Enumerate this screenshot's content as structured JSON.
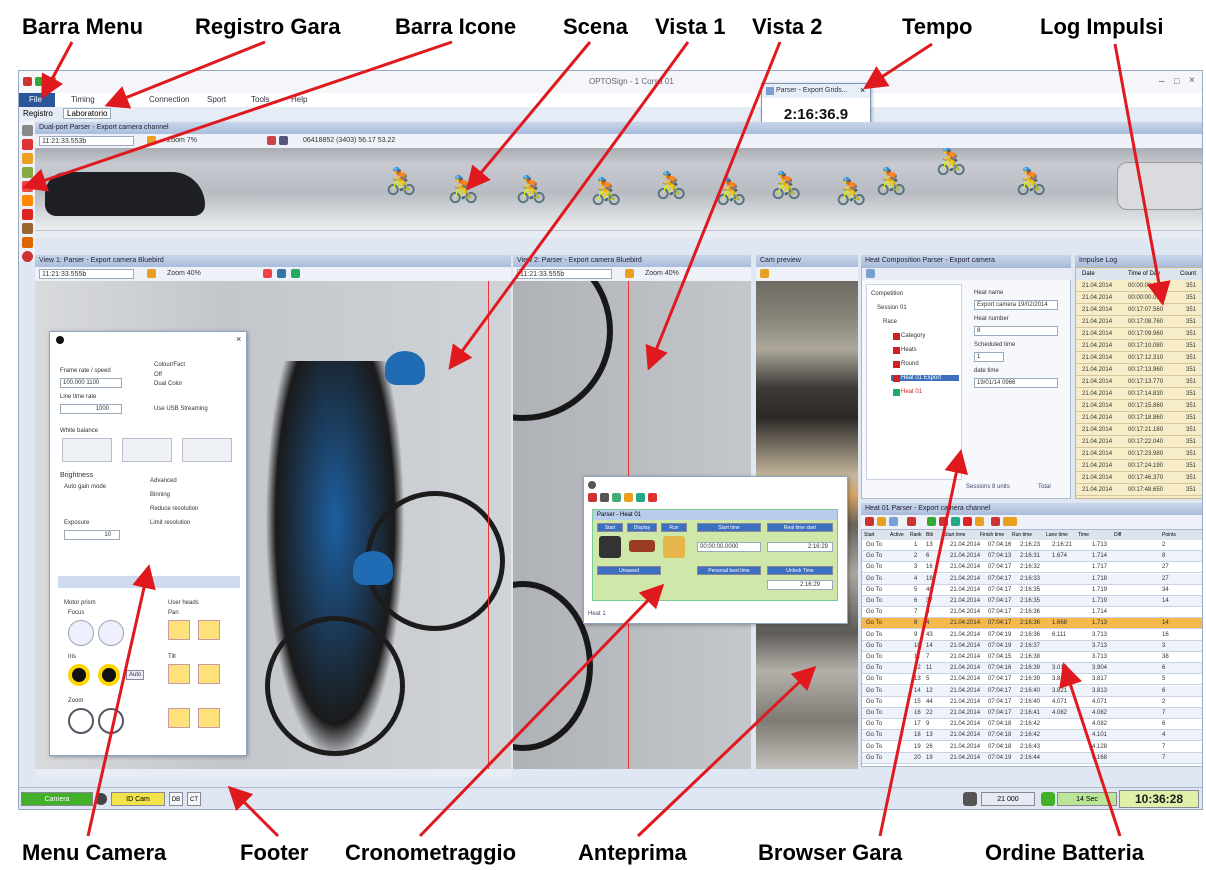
{
  "callouts": {
    "barra_menu": "Barra Menu",
    "registro_gara": "Registro Gara",
    "barra_icone": "Barra Icone",
    "scena": "Scena",
    "vista1": "Vista 1",
    "vista2": "Vista 2",
    "tempo": "Tempo",
    "log_impulsi": "Log Impulsi",
    "menu_camera": "Menu Camera",
    "footer": "Footer",
    "cronometraggio": "Cronometraggio",
    "anteprima": "Anteprima",
    "browser_gara": "Browser Gara",
    "ordine_batteria": "Ordine Batteria"
  },
  "colors": {
    "arrow": "#e0191f",
    "title_gradient_top": "#c9d6ea",
    "highlight_row": "#f5b94b",
    "footer_green": "#43b02a",
    "footer_yellow": "#f3e34a",
    "clock_bg": "#dff0a8"
  },
  "app": {
    "title": "OPTOSign - 1 Corsa 01",
    "menu": [
      "File",
      "Timing",
      "Connection",
      "Sport",
      "Tools",
      "Help"
    ],
    "register": {
      "label": "Registro",
      "tab": "Laboratorio"
    },
    "tempo_popup": {
      "title": "Parser - Export Grids...",
      "time": "2:16:36.9"
    }
  },
  "scene": {
    "title": "Dual-port Parser - Export camera channel",
    "time": "11:21:33.553b",
    "zoom": "Zoom 7%",
    "info": "06418852 (3403) 56.17 53.22"
  },
  "vista1": {
    "title": "View 1: Parser - Export camera Bluebird",
    "time": "11:21:33.555b",
    "zoom": "Zoom 40%"
  },
  "vista2": {
    "title": "View 2: Parser - Export camera Bluebird",
    "time": "11:21:33.555b",
    "zoom": "Zoom 40%"
  },
  "preview": {
    "title": "Cam preview"
  },
  "camera_menu": {
    "frame_rate_label": "Frame rate / speed",
    "frame_rate_value": "100.000 1100",
    "line_rate_label": "Line time rate",
    "line_rate_value": "1000",
    "colour_label": "Colour/Fact",
    "colour_opt1": "Off",
    "colour_opt2": "Dual Color",
    "use_usb": "Use USB Streaming",
    "white_balance": "White balance",
    "brightness_label": "Brightness",
    "auto_gain": "Auto gain mode",
    "exposure_label": "Exposure",
    "exposure_value": "10",
    "advanced_label": "Advanced",
    "binning": "Binning",
    "reduce1": "Reduce resolution",
    "reduce2": "Limit resolution",
    "motor_label": "Motor prism",
    "focus_label": "Focus",
    "iris_label": "Iris",
    "zoom_label": "Zoom",
    "user_heads_label": "User heads",
    "pan_label": "Pan",
    "tilt_label": "Tilt",
    "auto_btn": "Auto"
  },
  "crono": {
    "title": "Parser - Heat 01",
    "cols": [
      "Start",
      "Display",
      "Run",
      "Start time",
      "Real time start",
      "Unsaved",
      "Personal best time",
      "Unlock Time"
    ],
    "start_value": "00:00:00.0000",
    "real_value": "2:16:29",
    "unlock_value": "2:16:29",
    "status": "Heat 1"
  },
  "browser": {
    "title": "Heat Composition Parser - Export camera",
    "tree": [
      "Competition",
      "Session 01",
      "Race",
      "Category",
      "Heats",
      "Round",
      "Heat 01 Export",
      "Heat 01"
    ],
    "fields": {
      "heat_name_label": "Heat name",
      "heat_name_value": "Export camera 19/02/2014",
      "heat_number_label": "Heat number",
      "heat_number_value": "8",
      "scheduled_label": "Scheduled time",
      "scheduled_value": "1",
      "date_label": "date time",
      "date_value": "19/01/14 0966"
    },
    "footer_sessions": "Sessions 8 units",
    "footer_total": "Total"
  },
  "log": {
    "title": "Impulse Log",
    "headers": [
      "Date",
      "Time of Day",
      "Count"
    ],
    "rows": [
      [
        "21.04.2014",
        "00:00:00.000",
        "351"
      ],
      [
        "21.04.2014",
        "00:00:00.000",
        "351"
      ],
      [
        "21.04.2014",
        "00:17:07.560",
        "351"
      ],
      [
        "21.04.2014",
        "00:17:08.760",
        "351"
      ],
      [
        "21.04.2014",
        "00:17:09.960",
        "351"
      ],
      [
        "21.04.2014",
        "00:17:10.080",
        "351"
      ],
      [
        "21.04.2014",
        "00:17:12.310",
        "351"
      ],
      [
        "21.04.2014",
        "00:17:13.960",
        "351"
      ],
      [
        "21.04.2014",
        "00:17:13.770",
        "351"
      ],
      [
        "21.04.2014",
        "00:17:14.830",
        "351"
      ],
      [
        "21.04.2014",
        "00:17:15.860",
        "351"
      ],
      [
        "21.04.2014",
        "00:17:18.860",
        "351"
      ],
      [
        "21.04.2014",
        "00:17:21.180",
        "351"
      ],
      [
        "21.04.2014",
        "00:17:22.040",
        "351"
      ],
      [
        "21.04.2014",
        "00:17:23.980",
        "351"
      ],
      [
        "21.04.2014",
        "00:17:24.190",
        "351"
      ],
      [
        "21.04.2014",
        "00:17:46.370",
        "351"
      ],
      [
        "21.04.2014",
        "00:17:48.650",
        "351"
      ]
    ]
  },
  "order": {
    "title": "Heat 01 Parser - Export camera channel",
    "headers": [
      "Start",
      "Active",
      "Rank",
      "Bib",
      "Start time",
      "Finish time",
      "Run time",
      "Lane time",
      "Time",
      "Diff",
      "Points"
    ],
    "rows": [
      [
        "Go To",
        "1",
        "13",
        "21.04.2014",
        "07:04:16",
        "2:16:23",
        "2:16:21",
        "1.713",
        "2"
      ],
      [
        "Go To",
        "2",
        "6",
        "21.04.2014",
        "07:04:13",
        "2:16:31",
        "1.674",
        "1.714",
        "8"
      ],
      [
        "Go To",
        "3",
        "16",
        "21.04.2014",
        "07:04:17",
        "2:16:32",
        "",
        "1.717",
        "27"
      ],
      [
        "Go To",
        "4",
        "18",
        "21.04.2014",
        "07:04:17",
        "2:16:33",
        "",
        "1.718",
        "27"
      ],
      [
        "Go To",
        "5",
        "40",
        "21.04.2014",
        "07:04:17",
        "2:16:35",
        "",
        "1.719",
        "34"
      ],
      [
        "Go To",
        "6",
        "37",
        "21.04.2014",
        "07:04:17",
        "2:16:35",
        "",
        "1.719",
        "14"
      ],
      [
        "Go To",
        "7",
        "8",
        "21.04.2014",
        "07:04:17",
        "2:16:36",
        "",
        "1.714",
        ""
      ],
      [
        "Go To",
        "8",
        "4",
        "21.04.2014",
        "07:04:17",
        "2:16:36",
        "1.668",
        "1.713",
        "14"
      ],
      [
        "Go To",
        "9",
        "43",
        "21.04.2014",
        "07:04:19",
        "2:16:36",
        "6.111",
        "3.713",
        "16"
      ],
      [
        "Go To",
        "10",
        "14",
        "21.04.2014",
        "07:04:19",
        "2:16:37",
        "",
        "3.713",
        "3"
      ],
      [
        "Go To",
        "11",
        "7",
        "21.04.2014",
        "07:04:15",
        "2:16:38",
        "",
        "3.713",
        "38"
      ],
      [
        "Go To",
        "12",
        "11",
        "21.04.2014",
        "07:04:16",
        "2:16:39",
        "3.013",
        "3.904",
        "6"
      ],
      [
        "Go To",
        "13",
        "5",
        "21.04.2014",
        "07:04:17",
        "2:16:39",
        "3.817",
        "3.817",
        "5"
      ],
      [
        "Go To",
        "14",
        "12",
        "21.04.2014",
        "07:04:17",
        "2:16:40",
        "3.821",
        "3.813",
        "6"
      ],
      [
        "Go To",
        "15",
        "44",
        "21.04.2014",
        "07:04:17",
        "2:16:40",
        "4.071",
        "4.071",
        "2"
      ],
      [
        "Go To",
        "16",
        "22",
        "21.04.2014",
        "07:04:17",
        "2:16:41",
        "4.082",
        "4.082",
        "7"
      ],
      [
        "Go To",
        "17",
        "9",
        "21.04.2014",
        "07:04:18",
        "2:16:42",
        "",
        "4.082",
        "6"
      ],
      [
        "Go To",
        "18",
        "13",
        "21.04.2014",
        "07:04:18",
        "2:16:42",
        "",
        "4.101",
        "4"
      ],
      [
        "Go To",
        "19",
        "26",
        "21.04.2014",
        "07:04:18",
        "2:16:43",
        "",
        "4.128",
        "7"
      ],
      [
        "Go To",
        "20",
        "19",
        "21.04.2014",
        "07:04:19",
        "2:16:44",
        "",
        "4.168",
        "7"
      ]
    ]
  },
  "footer": {
    "camera_label": "Camera",
    "sync_label": "ID Cam",
    "btn_a": "DB",
    "btn_b": "CT",
    "right_label": "21 000",
    "status_label": "14 Sec",
    "clock": "10:36:28"
  }
}
